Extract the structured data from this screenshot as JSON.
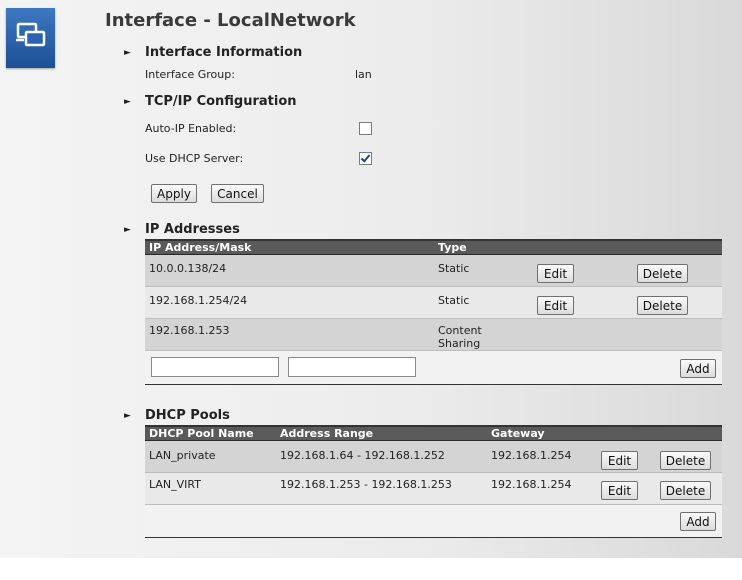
{
  "page": {
    "title": "Interface - LocalNetwork",
    "logo_icon": "network-interface-icon"
  },
  "interface_info": {
    "heading": "Interface Information",
    "group_label": "Interface Group:",
    "group_value": "lan"
  },
  "tcpip": {
    "heading": "TCP/IP Configuration",
    "auto_ip_label": "Auto-IP Enabled:",
    "auto_ip_checked": false,
    "dhcp_label": "Use DHCP Server:",
    "dhcp_checked": true,
    "apply_label": "Apply",
    "cancel_label": "Cancel"
  },
  "ip_addresses": {
    "heading": "IP Addresses",
    "columns": [
      "IP Address/Mask",
      "Type"
    ],
    "rows": [
      {
        "address": "10.0.0.138/24",
        "type": "Static",
        "edit": "Edit",
        "delete": "Delete"
      },
      {
        "address": "192.168.1.254/24",
        "type": "Static",
        "edit": "Edit",
        "delete": "Delete"
      },
      {
        "address": "192.168.1.253",
        "type_line1": "Content",
        "type_line2": "Sharing"
      }
    ],
    "new_address_value": "",
    "new_mask_value": "",
    "add_label": "Add"
  },
  "dhcp_pools": {
    "heading": "DHCP Pools",
    "columns": [
      "DHCP Pool Name",
      "Address Range",
      "Gateway"
    ],
    "rows": [
      {
        "name": "LAN_private",
        "range": "192.168.1.64 - 192.168.1.252",
        "gateway": "192.168.1.254",
        "edit": "Edit",
        "delete": "Delete"
      },
      {
        "name": "LAN_VIRT",
        "range": "192.168.1.253 - 192.168.1.253",
        "gateway": "192.168.1.254",
        "edit": "Edit",
        "delete": "Delete"
      }
    ],
    "add_label": "Add"
  }
}
